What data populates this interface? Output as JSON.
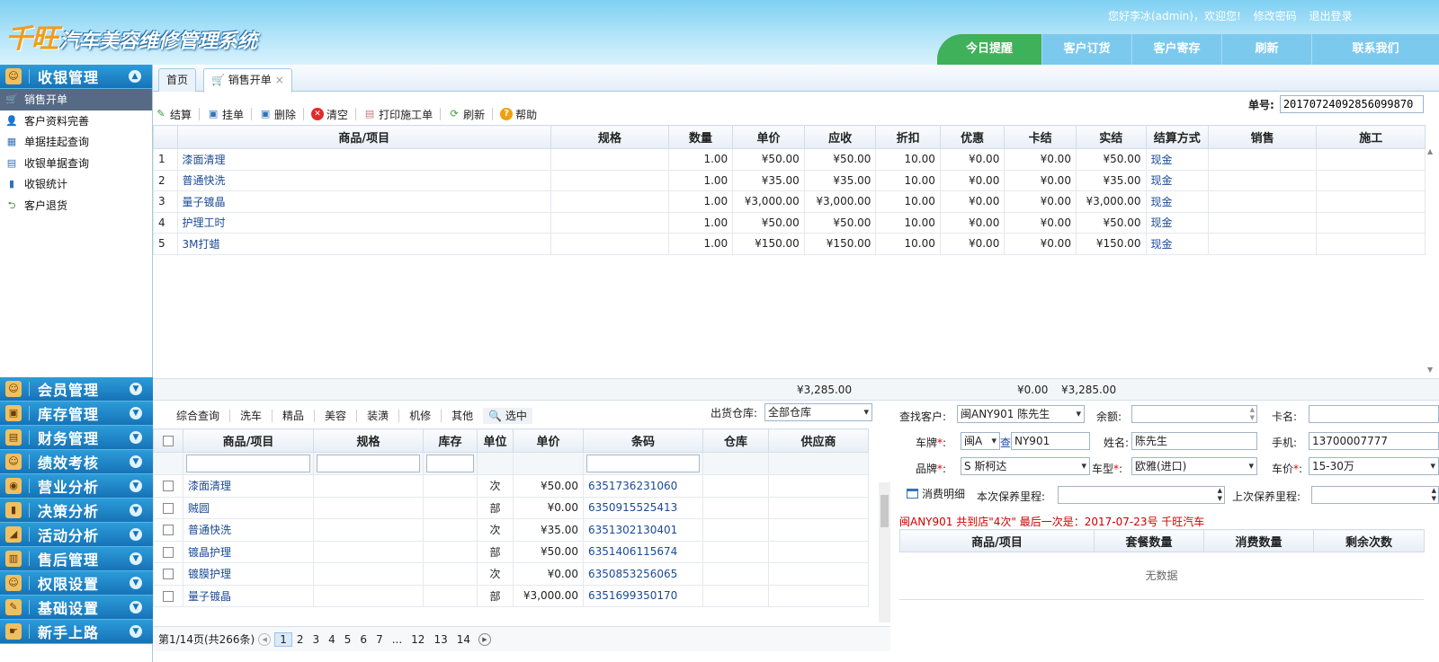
{
  "header": {
    "brand": "千旺",
    "system_name": "汽车美容维修管理系统",
    "greeting": "您好李冰(admin)，欢迎您!",
    "change_password": "修改密码",
    "logout": "退出登录",
    "nav": [
      "今日提醒",
      "客户订货",
      "客户寄存",
      "刷新",
      "联系我们"
    ]
  },
  "sidebar": {
    "top_module": "收银管理",
    "sub_items": [
      "销售开单",
      "客户资料完善",
      "单据挂起查询",
      "收银单据查询",
      "收银统计",
      "客户退货"
    ],
    "modules": [
      "会员管理",
      "库存管理",
      "财务管理",
      "绩效考核",
      "营业分析",
      "决策分析",
      "活动分析",
      "售后管理",
      "权限设置",
      "基础设置",
      "新手上路"
    ]
  },
  "tabs": {
    "home": "首页",
    "sales": "销售开单",
    "close": "×"
  },
  "toolbar": {
    "items": [
      "结算",
      "挂单",
      "删除",
      "清空",
      "打印施工单",
      "刷新",
      "帮助"
    ],
    "order_label": "单号:",
    "order_no": "20170724092856099870"
  },
  "sales": {
    "columns": [
      "商品/项目",
      "规格",
      "数量",
      "单价",
      "应收",
      "折扣",
      "优惠",
      "卡结",
      "实结",
      "结算方式",
      "销售",
      "施工"
    ],
    "rows": [
      [
        "1",
        "漆面清理",
        "",
        "1.00",
        "¥50.00",
        "¥50.00",
        "10.00",
        "¥0.00",
        "¥0.00",
        "¥50.00",
        "现金",
        "",
        ""
      ],
      [
        "2",
        "普通快洗",
        "",
        "1.00",
        "¥35.00",
        "¥35.00",
        "10.00",
        "¥0.00",
        "¥0.00",
        "¥35.00",
        "现金",
        "",
        ""
      ],
      [
        "3",
        "量子镀晶",
        "",
        "1.00",
        "¥3,000.00",
        "¥3,000.00",
        "10.00",
        "¥0.00",
        "¥0.00",
        "¥3,000.00",
        "现金",
        "",
        ""
      ],
      [
        "4",
        "护理工时",
        "",
        "1.00",
        "¥50.00",
        "¥50.00",
        "10.00",
        "¥0.00",
        "¥0.00",
        "¥50.00",
        "现金",
        "",
        ""
      ],
      [
        "5",
        "3M打蜡",
        "",
        "1.00",
        "¥150.00",
        "¥150.00",
        "10.00",
        "¥0.00",
        "¥0.00",
        "¥150.00",
        "现金",
        "",
        ""
      ]
    ],
    "totals": {
      "receivable": "¥3,285.00",
      "card": "¥0.00",
      "actual": "¥3,285.00"
    }
  },
  "catalog": {
    "categories": [
      "综合查询",
      "洗车",
      "精品",
      "美容",
      "装潢",
      "机修",
      "其他"
    ],
    "selected_label": "选中",
    "warehouse_label": "出货仓库:",
    "warehouse": "全部仓库",
    "columns": [
      "商品/项目",
      "规格",
      "库存",
      "单位",
      "单价",
      "条码",
      "仓库",
      "供应商"
    ],
    "rows": [
      [
        "漆面清理",
        "",
        "",
        "次",
        "¥50.00",
        "6351736231060",
        "",
        ""
      ],
      [
        "贼圆",
        "",
        "",
        "部",
        "¥0.00",
        "6350915525413",
        "",
        ""
      ],
      [
        "普通快洗",
        "",
        "",
        "次",
        "¥35.00",
        "6351302130401",
        "",
        ""
      ],
      [
        "镀晶护理",
        "",
        "",
        "部",
        "¥50.00",
        "6351406115674",
        "",
        ""
      ],
      [
        "镀膜护理",
        "",
        "",
        "次",
        "¥0.00",
        "6350853256065",
        "",
        ""
      ],
      [
        "量子镀晶",
        "",
        "",
        "部",
        "¥3,000.00",
        "6351699350170",
        "",
        ""
      ]
    ],
    "pager": {
      "summary": "第1/14页(共266条)",
      "pages": [
        "1",
        "2",
        "3",
        "4",
        "5",
        "6",
        "7",
        "...",
        "12",
        "13",
        "14"
      ]
    }
  },
  "customer": {
    "find_label": "查找客户:",
    "find_value": "闽ANY901  陈先生",
    "balance_label": "余额:",
    "balance_value": "",
    "card_label": "卡名:",
    "card_value": "",
    "plate_label": "车牌",
    "plate_prefix": "闽A",
    "plate_check": "查",
    "plate_value": "NY901",
    "name_label": "姓名:",
    "name_value": "陈先生",
    "phone_label": "手机:",
    "phone_value": "13700007777",
    "brand_label": "品牌",
    "brand_value": "S 斯柯达",
    "model_label": "车型",
    "model_value": "欧雅(进口)",
    "price_label": "车价",
    "price_value": "15-30万",
    "detail_label": "消费明细",
    "next_label": "本次保养里程:",
    "next_value": "",
    "last_label": "上次保养里程:",
    "last_value": "",
    "info": "闽ANY901 共到店\"4次\" 最后一次是：2017-07-23号 千旺汽车",
    "pkg_columns": [
      "商品/项目",
      "套餐数量",
      "消费数量",
      "剩余次数"
    ],
    "no_data": "无数据"
  }
}
